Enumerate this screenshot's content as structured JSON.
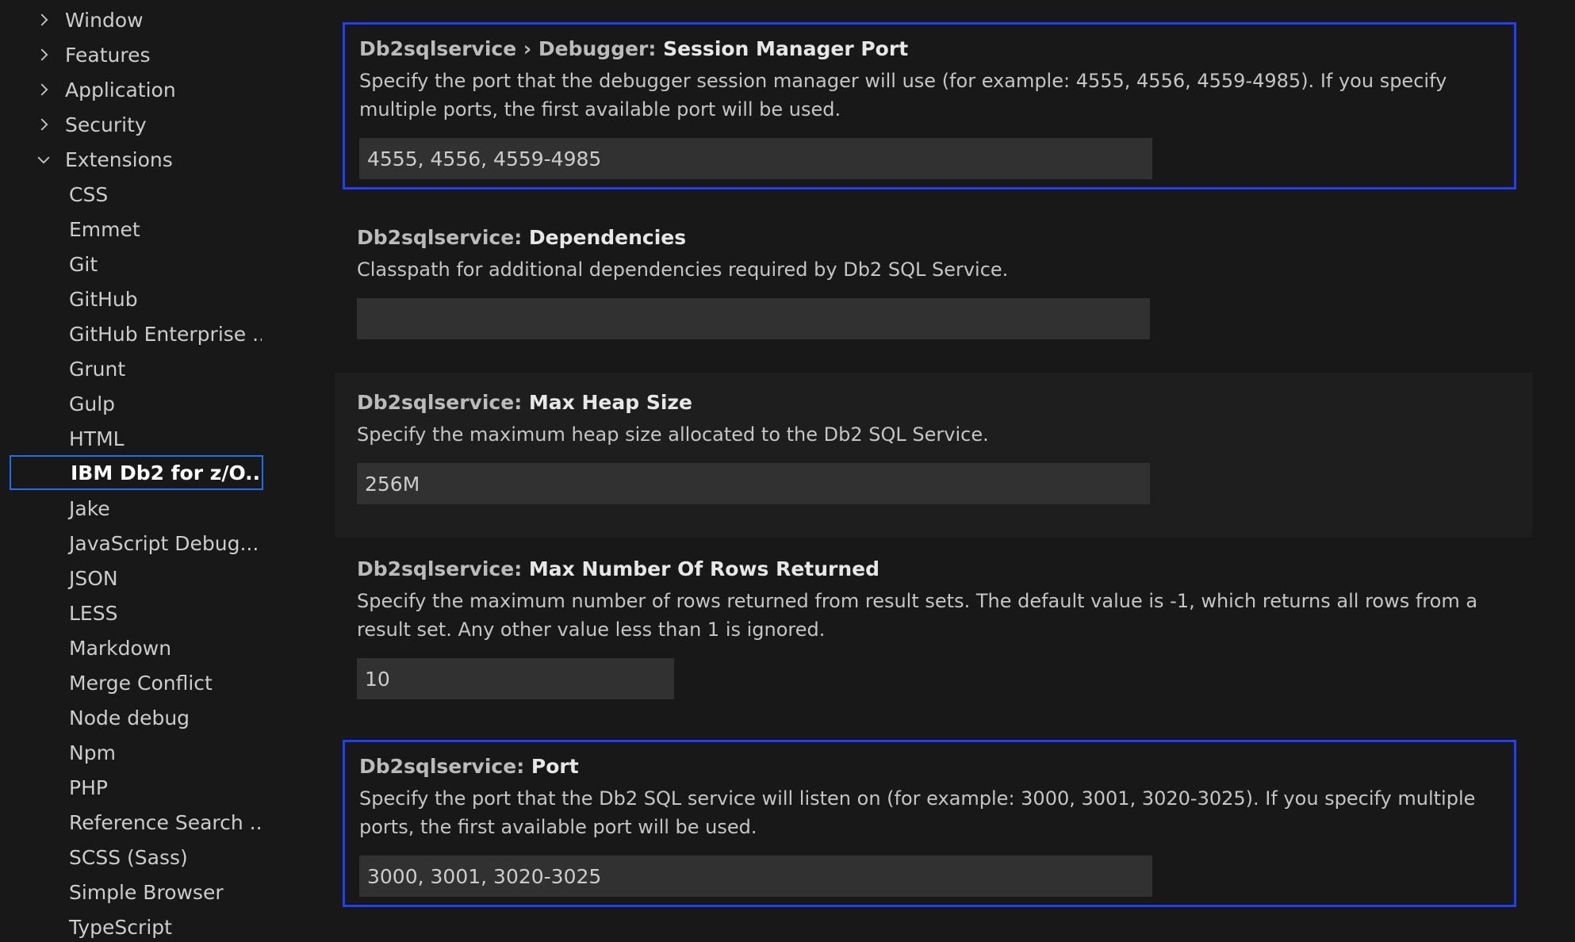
{
  "sidebar": {
    "top_items": [
      {
        "label": "Window",
        "expanded": false
      },
      {
        "label": "Features",
        "expanded": false
      },
      {
        "label": "Application",
        "expanded": false
      },
      {
        "label": "Security",
        "expanded": false
      },
      {
        "label": "Extensions",
        "expanded": true
      }
    ],
    "extensions": [
      "CSS",
      "Emmet",
      "Git",
      "GitHub",
      "GitHub Enterprise ...",
      "Grunt",
      "Gulp",
      "HTML",
      "IBM Db2 for z/O...",
      "Jake",
      "JavaScript Debug...",
      "JSON",
      "LESS",
      "Markdown",
      "Merge Conflict",
      "Node debug",
      "Npm",
      "PHP",
      "Reference Search ...",
      "SCSS (Sass)",
      "Simple Browser",
      "TypeScript"
    ],
    "selected": "IBM Db2 for z/O..."
  },
  "settings": [
    {
      "category": "Db2sqlservice › Debugger: ",
      "name": "Session Manager Port",
      "description": "Specify the port that the debugger session manager will use (for example: 4555, 4556, 4559-4985). If you specify multiple ports, the first available port will be used.",
      "value": "4555, 4556, 4559-4985"
    },
    {
      "category": "Db2sqlservice: ",
      "name": "Dependencies",
      "description": "Classpath for additional dependencies required by Db2 SQL Service.",
      "value": ""
    },
    {
      "category": "Db2sqlservice: ",
      "name": "Max Heap Size",
      "description": "Specify the maximum heap size allocated to the Db2 SQL Service.",
      "value": "256M"
    },
    {
      "category": "Db2sqlservice: ",
      "name": "Max Number Of Rows Returned",
      "description": "Specify the maximum number of rows returned from result sets. The default value is -1, which returns all rows from a result set. Any other value less than 1 is ignored.",
      "value": "10"
    },
    {
      "category": "Db2sqlservice: ",
      "name": "Port",
      "description": "Specify the port that the Db2 SQL service will listen on (for example: 3000, 3001, 3020-3025). If you specify multiple ports, the first available port will be used.",
      "value": "3000, 3001, 3020-3025"
    }
  ],
  "colors": {
    "background": "#181818",
    "focus_border": "#1f3fff",
    "selected_border": "#1f6feb",
    "input_background": "#313131"
  }
}
